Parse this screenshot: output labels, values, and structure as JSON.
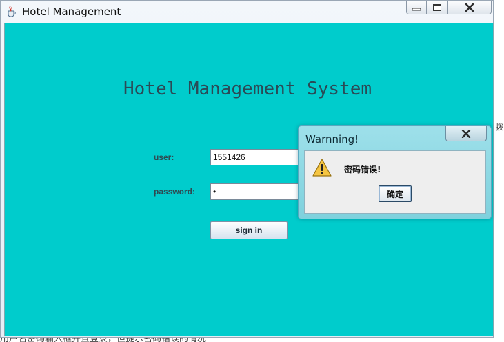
{
  "window": {
    "title": "Hotel Management",
    "minimize_glyph": "▭",
    "maximize_glyph": "□",
    "close_glyph": "✕"
  },
  "app": {
    "heading": "Hotel Management System",
    "background_color": "#00cccc"
  },
  "login": {
    "user_label": "user:",
    "user_value": "1551426",
    "password_label": "password:",
    "password_value": "•",
    "signin_label": "sign in"
  },
  "dialog": {
    "title": "Warnning!",
    "message": "密码错误!",
    "ok_label": "确定",
    "icon": "warning-icon",
    "close_glyph": "✕"
  },
  "background": {
    "edge_fragment": "拨",
    "bottom_text": "用户名密码输入框并且登录，但提示密码错误的情况"
  }
}
